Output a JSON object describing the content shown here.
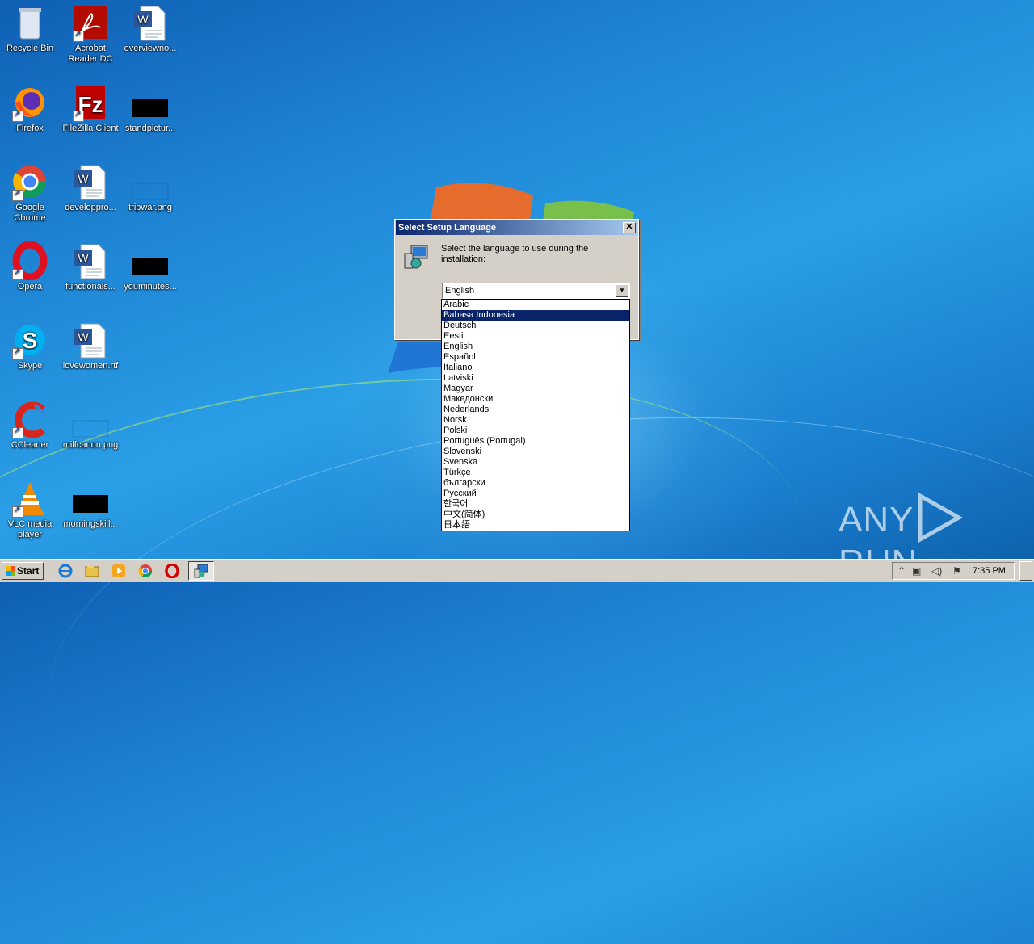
{
  "desktop": {
    "icons": [
      {
        "label": "Recycle Bin"
      },
      {
        "label": "Acrobat Reader DC"
      },
      {
        "label": "overviewno..."
      },
      {
        "label": "Firefox"
      },
      {
        "label": "FileZilla Client"
      },
      {
        "label": "standpictur..."
      },
      {
        "label": "Google Chrome"
      },
      {
        "label": "developpro..."
      },
      {
        "label": "tripwar.png"
      },
      {
        "label": "Opera"
      },
      {
        "label": "functionals..."
      },
      {
        "label": "youminutes..."
      },
      {
        "label": "Skype"
      },
      {
        "label": "lovewomen.rtf"
      },
      {
        "label": "CCleaner"
      },
      {
        "label": "milfcanon.png"
      },
      {
        "label": "VLC media player"
      },
      {
        "label": "morningskill..."
      }
    ]
  },
  "dialog": {
    "title": "Select Setup Language",
    "close_label": "✕",
    "message": "Select the language to use during the installation:",
    "selected_value": "English",
    "options": [
      "Arabic",
      "Bahasa Indonesia",
      "Deutsch",
      "Eesti",
      "English",
      "Español",
      "Italiano",
      "Latviski",
      "Magyar",
      "Македонски",
      "Nederlands",
      "Norsk",
      "Polski",
      "Português (Portugal)",
      "Slovenski",
      "Svenska",
      "Türkçe",
      "български",
      "Русский",
      "한국어",
      "中文(简体)",
      "日本語"
    ],
    "highlighted_option": "Bahasa Indonesia"
  },
  "watermark": {
    "text_left": "ANY",
    "text_right": "RUN"
  },
  "taskbar": {
    "start_label": "Start",
    "clock": "7:35 PM"
  },
  "colors": {
    "selection": "#0a246a",
    "dialog_bg": "#d4d0c8",
    "desktop": "#1f86d6"
  }
}
